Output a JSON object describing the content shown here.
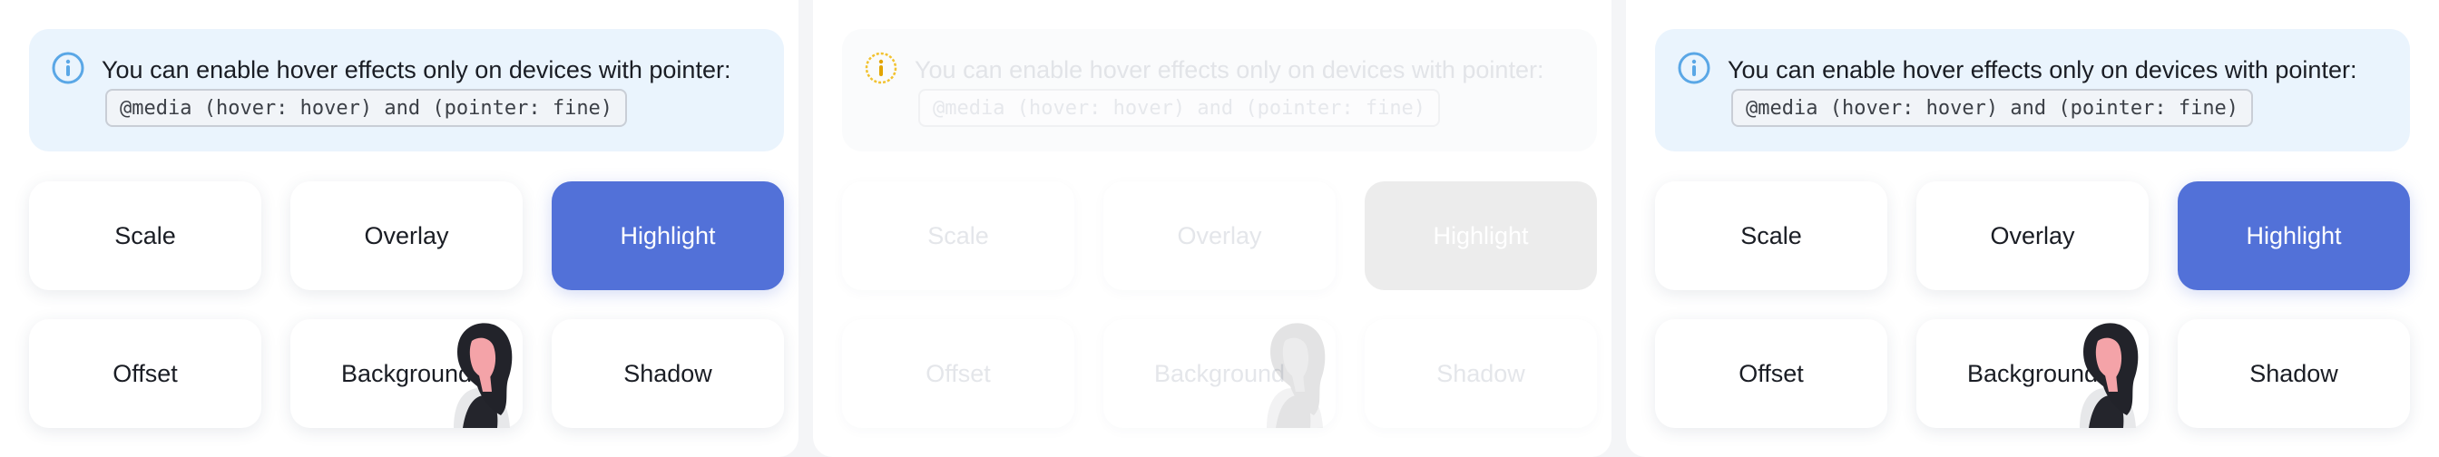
{
  "panels": [
    {
      "state": "normal",
      "info": {
        "icon": "info-icon",
        "text": "You can enable hover effects only on devices with pointer:",
        "code": "@media (hover: hover) and (pointer: fine)"
      },
      "buttons": [
        "Scale",
        "Overlay",
        "Highlight",
        "Offset",
        "Background",
        "Shadow"
      ],
      "active_button": "Highlight"
    },
    {
      "state": "faded",
      "info": {
        "icon": "warning-info-icon",
        "text": "You can enable hover effects only on devices with pointer:",
        "code": "@media (hover: hover) and (pointer: fine)"
      },
      "buttons": [
        "Scale",
        "Overlay",
        "Highlight",
        "Offset",
        "Background",
        "Shadow"
      ],
      "active_button": "Highlight"
    },
    {
      "state": "normal",
      "info": {
        "icon": "info-icon",
        "text": "You can enable hover effects only on devices with pointer:",
        "code": "@media (hover: hover) and (pointer: fine)"
      },
      "buttons": [
        "Scale",
        "Overlay",
        "Highlight",
        "Offset",
        "Background",
        "Shadow"
      ],
      "active_button": "Highlight"
    }
  ],
  "colors": {
    "accent": "#5271d8",
    "info_bg": "#eaf4fd",
    "info_icon": "#5aa7e6",
    "warning_icon": "#f2c230"
  }
}
